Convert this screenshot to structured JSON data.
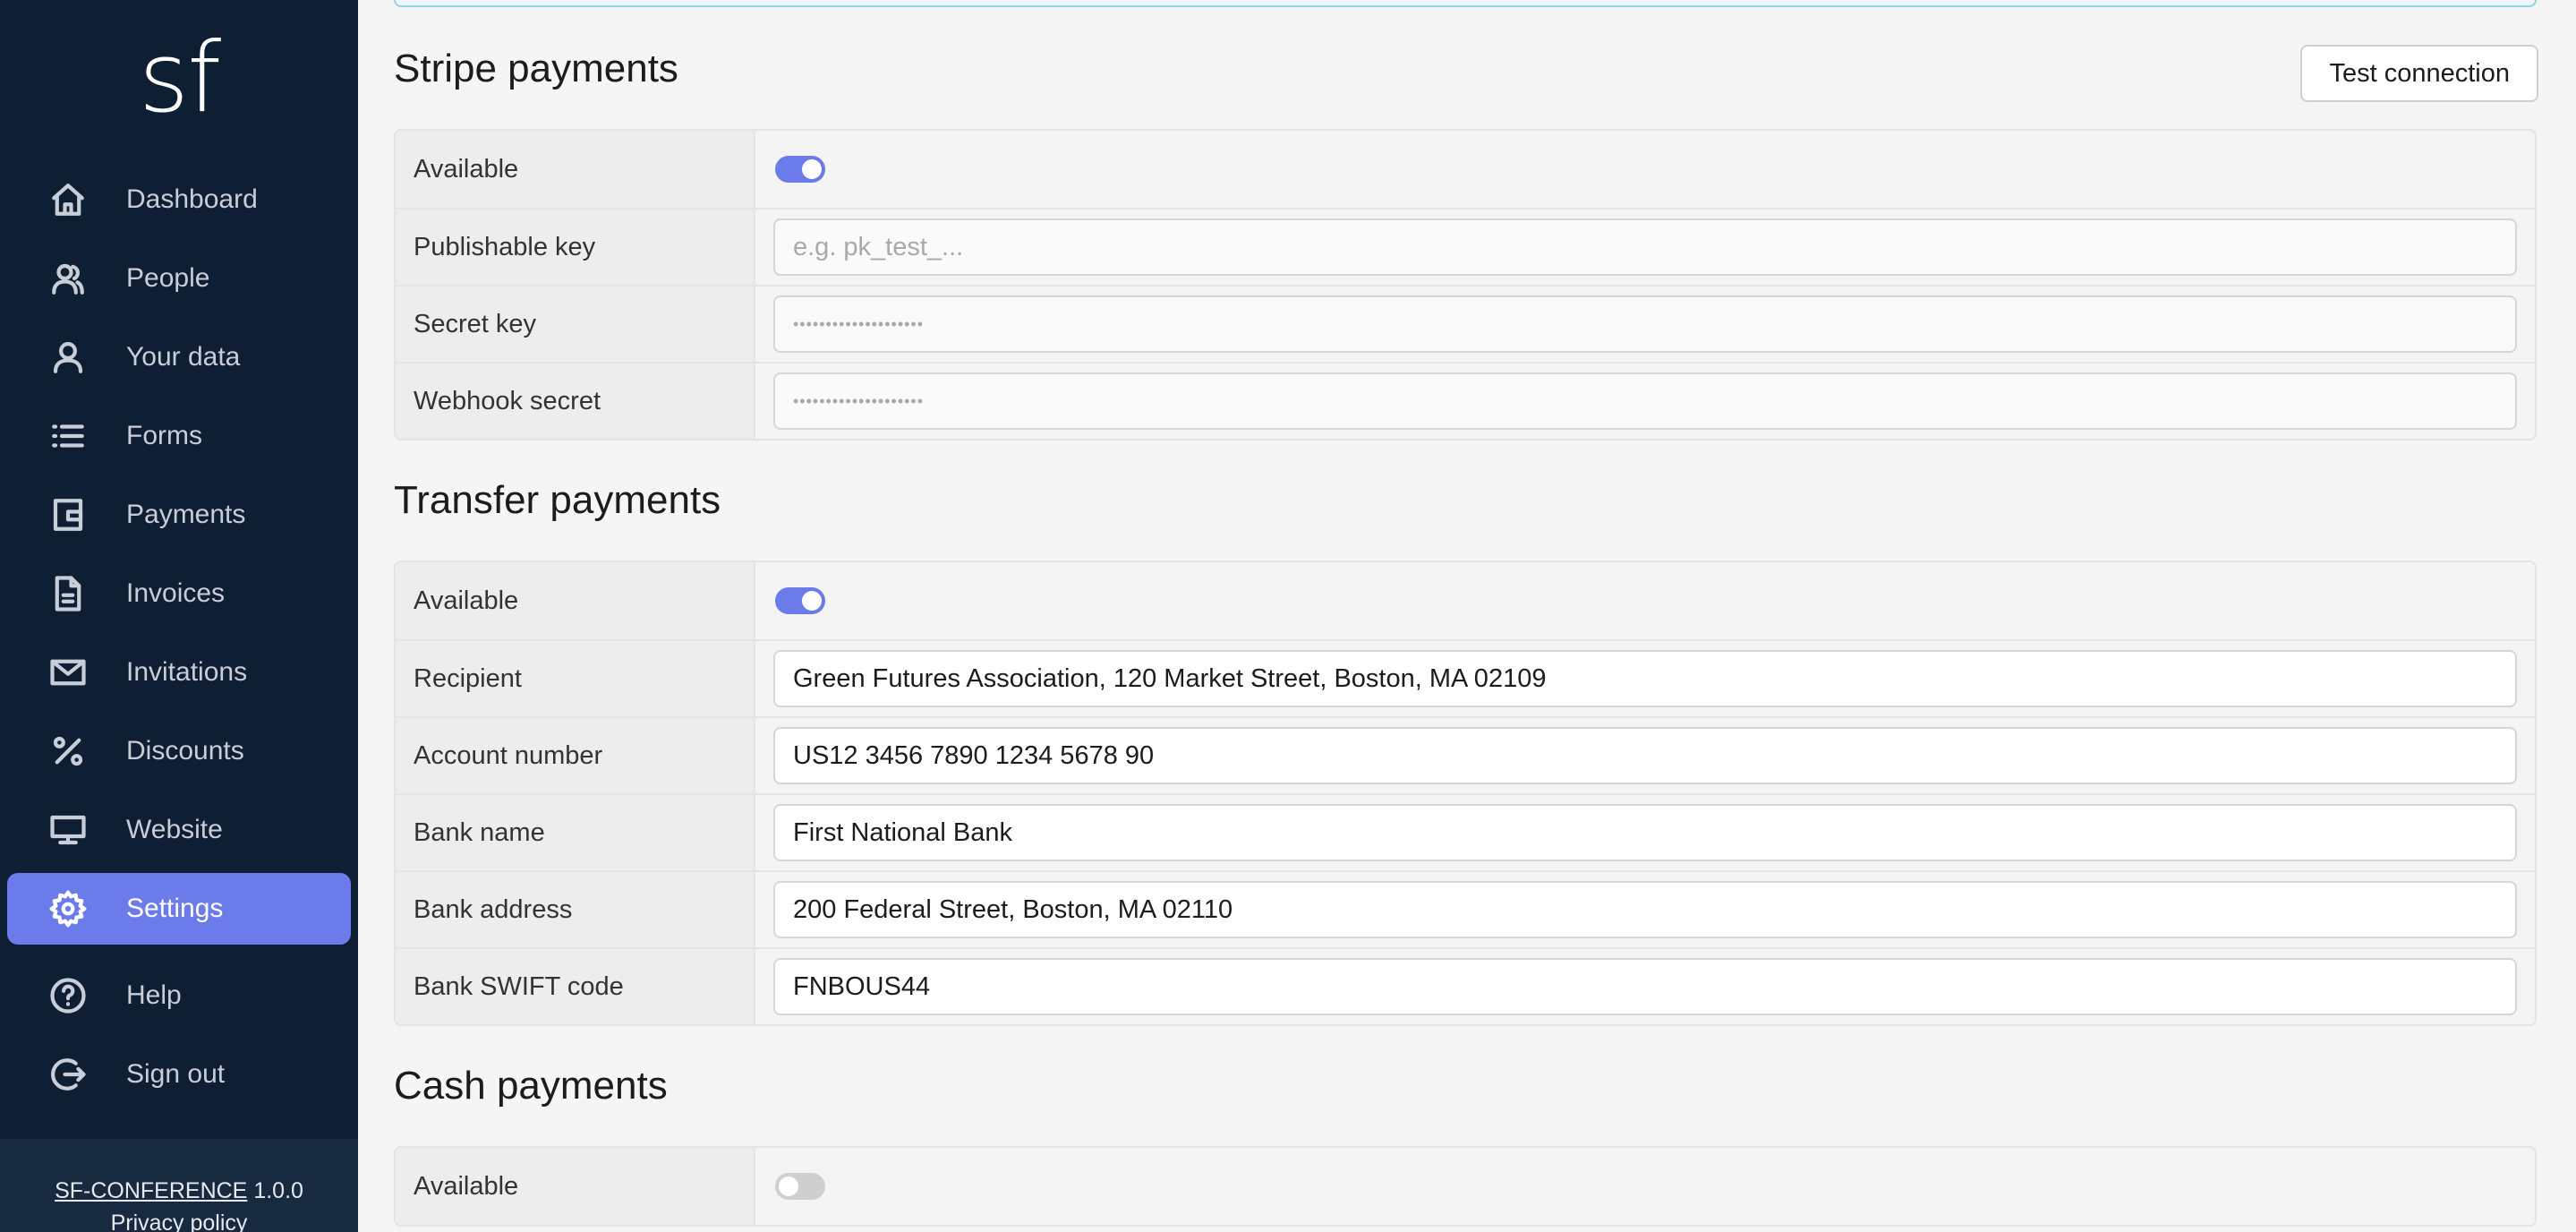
{
  "sidebar": {
    "logo": "sf",
    "items": [
      {
        "label": "Dashboard",
        "icon": "home-icon"
      },
      {
        "label": "People",
        "icon": "people-icon"
      },
      {
        "label": "Your data",
        "icon": "user-icon"
      },
      {
        "label": "Forms",
        "icon": "list-icon"
      },
      {
        "label": "Payments",
        "icon": "wallet-icon"
      },
      {
        "label": "Invoices",
        "icon": "document-icon"
      },
      {
        "label": "Invitations",
        "icon": "mail-icon"
      },
      {
        "label": "Discounts",
        "icon": "percent-icon"
      },
      {
        "label": "Website",
        "icon": "monitor-icon"
      },
      {
        "label": "Settings",
        "icon": "gear-icon",
        "active": true
      }
    ],
    "bottom_items": [
      {
        "label": "Help",
        "icon": "help-icon"
      },
      {
        "label": "Sign out",
        "icon": "sign-out-icon"
      }
    ],
    "footer": {
      "app_name": "SF-CONFERENCE",
      "version": "1.0.0",
      "privacy": "Privacy policy"
    }
  },
  "stripe": {
    "title": "Stripe payments",
    "test_button": "Test connection",
    "available_label": "Available",
    "available": true,
    "publishable_key_label": "Publishable key",
    "publishable_key_placeholder": "e.g. pk_test_...",
    "publishable_key_value": "",
    "secret_key_label": "Secret key",
    "secret_key_value": "••••••••••••••••••••",
    "webhook_secret_label": "Webhook secret",
    "webhook_secret_value": "••••••••••••••••••••"
  },
  "transfer": {
    "title": "Transfer payments",
    "available_label": "Available",
    "available": true,
    "recipient_label": "Recipient",
    "recipient_value": "Green Futures Association, 120 Market Street, Boston, MA 02109",
    "account_label": "Account number",
    "account_value": "US12 3456 7890 1234 5678 90",
    "bank_name_label": "Bank name",
    "bank_name_value": "First National Bank",
    "bank_address_label": "Bank address",
    "bank_address_value": "200 Federal Street, Boston, MA 02110",
    "swift_label": "Bank SWIFT code",
    "swift_value": "FNBOUS44"
  },
  "cash": {
    "title": "Cash payments",
    "available_label": "Available",
    "available": false
  },
  "colors": {
    "sidebar_bg": "#0f1f33",
    "accent": "#6b7bea",
    "footer_bg": "#182a40"
  }
}
